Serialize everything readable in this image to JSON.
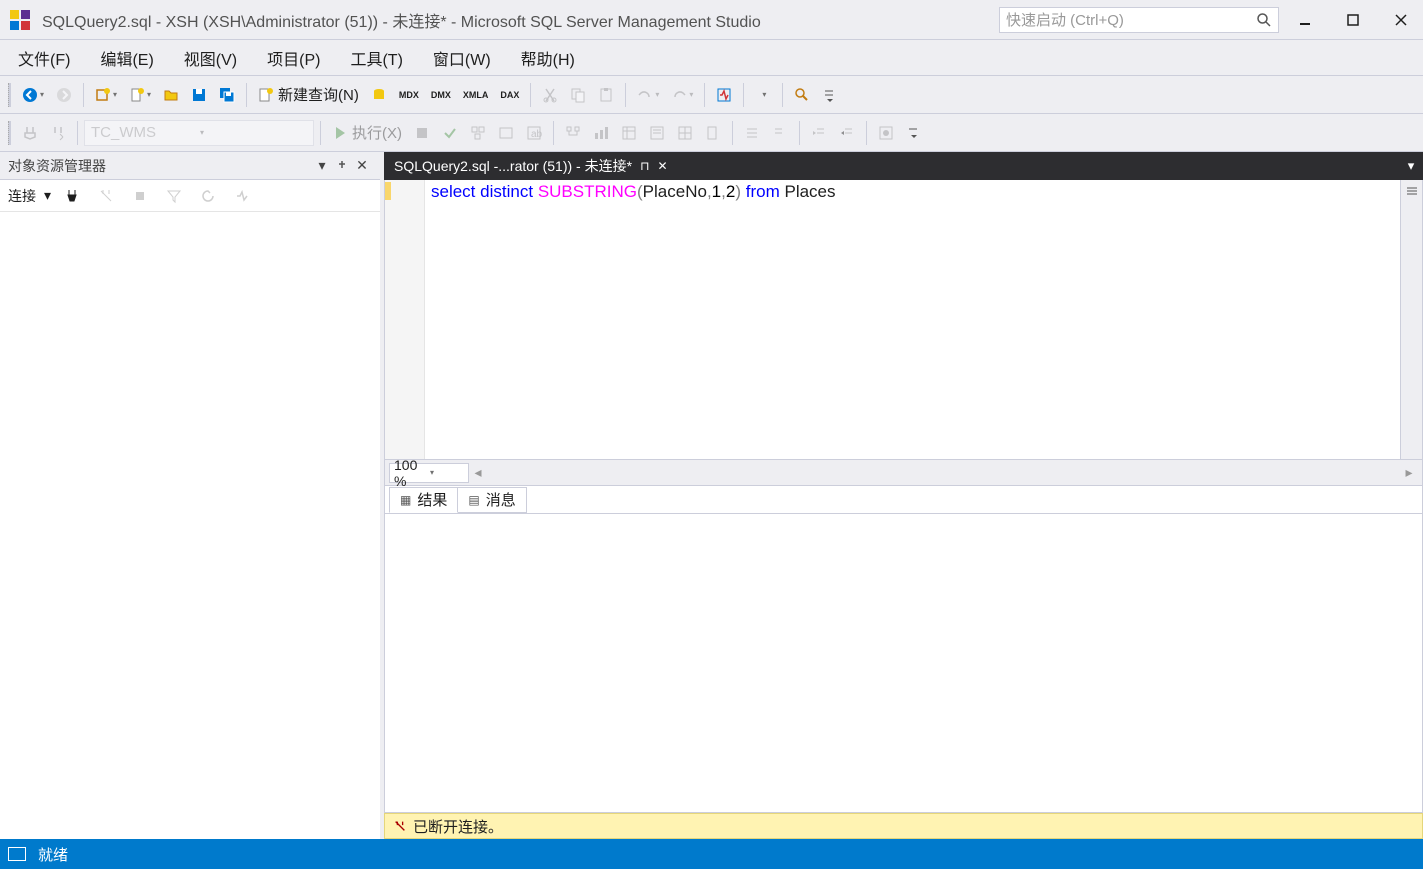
{
  "titlebar": {
    "title": "SQLQuery2.sql - XSH (XSH\\Administrator (51)) - 未连接* - Microsoft SQL Server Management Studio",
    "quicklaunch_placeholder": "快速启动 (Ctrl+Q)"
  },
  "menu": {
    "file": "文件(F)",
    "edit": "编辑(E)",
    "view": "视图(V)",
    "project": "项目(P)",
    "tools": "工具(T)",
    "window": "窗口(W)",
    "help": "帮助(H)"
  },
  "toolbar1": {
    "newquery": "新建查询(N)",
    "mdx": "MDX",
    "dmx": "DMX",
    "xmla": "XMLA",
    "dax": "DAX"
  },
  "toolbar2": {
    "dbcombo": "TC_WMS",
    "execute": "执行(X)"
  },
  "object_explorer": {
    "title": "对象资源管理器",
    "connect_label": "连接"
  },
  "tabs": {
    "active": "SQLQuery2.sql -...rator (51)) - 未连接*"
  },
  "editor": {
    "code_tokens": [
      {
        "t": "select",
        "c": "kw"
      },
      {
        "t": " ",
        "c": ""
      },
      {
        "t": "distinct",
        "c": "kw"
      },
      {
        "t": " ",
        "c": ""
      },
      {
        "t": "SUBSTRING",
        "c": "fn"
      },
      {
        "t": "(",
        "c": "punct"
      },
      {
        "t": "PlaceNo",
        "c": ""
      },
      {
        "t": ",",
        "c": "punct"
      },
      {
        "t": "1",
        "c": "num"
      },
      {
        "t": ",",
        "c": "punct"
      },
      {
        "t": "2",
        "c": "num"
      },
      {
        "t": ")",
        "c": "punct"
      },
      {
        "t": " ",
        "c": ""
      },
      {
        "t": "from",
        "c": "kw"
      },
      {
        "t": " ",
        "c": ""
      },
      {
        "t": "Places",
        "c": ""
      }
    ],
    "zoom": "100 %"
  },
  "result_tabs": {
    "results": "结果",
    "messages": "消息"
  },
  "conn_status": "已断开连接。",
  "statusbar": {
    "ready": "就绪"
  }
}
